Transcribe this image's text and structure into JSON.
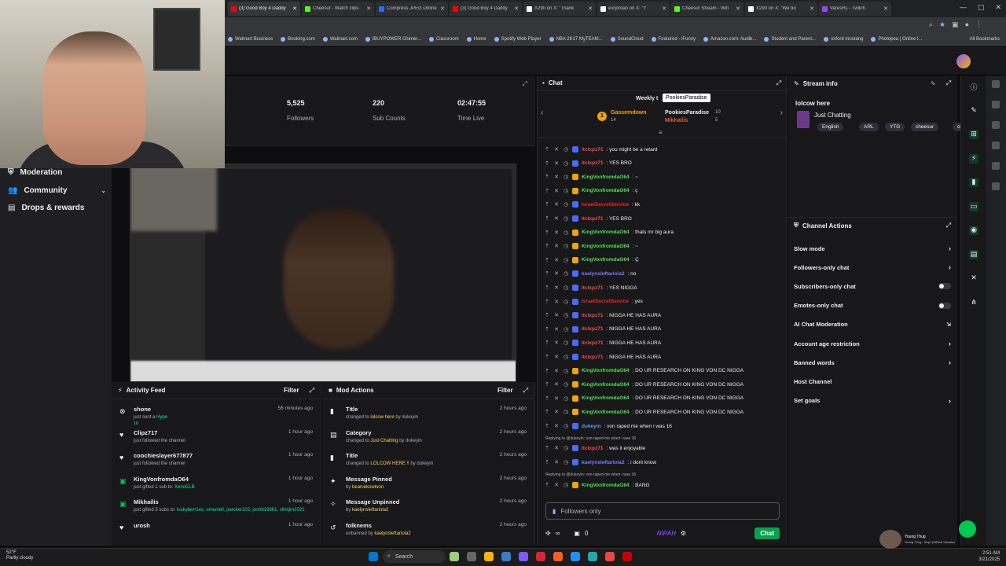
{
  "browser": {
    "tabs": [
      {
        "label": "(3) Good Boy 4 Daddy",
        "color": "#ff0000"
      },
      {
        "label": "Cheesur - Watch clips",
        "color": "#53fc18"
      },
      {
        "label": "Compress JPEG Online",
        "color": "#1a73e8"
      },
      {
        "label": "(3) Good Boy 4 Daddy",
        "color": "#ff0000"
      },
      {
        "label": "X290 on X: \"Thank",
        "color": "#ffffff"
      },
      {
        "label": "evrjordan on X: \"Y",
        "color": "#ffffff"
      },
      {
        "label": "Cheesur Stream - Win",
        "color": "#53fc18"
      },
      {
        "label": "X290 on X: \"We bo",
        "color": "#ffffff"
      },
      {
        "label": "VaresRL - Twitch",
        "color": "#9146ff"
      }
    ],
    "bookmarks": [
      "Walmart Business",
      "Booking.com",
      "Walmart.com",
      "iBUYPOWER Chimer...",
      "Classroom",
      "Home",
      "Spotify Web Player",
      "NBA 2K17 MyTEAM...",
      "SoundCloud",
      "Featured - iFunny",
      "Amazon.com: Audib...",
      "Student and Parent...",
      "oxford mustang",
      "Photopea | Online l..."
    ],
    "all_bookmarks": "All Bookmarks"
  },
  "sidebar": {
    "items": [
      {
        "label": "Moderation",
        "icon": "shield-icon"
      },
      {
        "label": "Community",
        "icon": "people-icon"
      },
      {
        "label": "Drops & rewards",
        "icon": "gift-icon"
      }
    ]
  },
  "stats": [
    {
      "value": "5,525",
      "label": "Followers"
    },
    {
      "value": "220",
      "label": "Sub Counts"
    },
    {
      "value": "02:47:55",
      "label": "Time Live"
    }
  ],
  "activity_feed": {
    "title": "Activity Feed",
    "filter": "Filter",
    "items": [
      {
        "name": "shone",
        "sub": "just sent a",
        "hl": "Hype",
        "extra": "10",
        "time": "56 minutes ago",
        "icon": "x-circle-icon"
      },
      {
        "name": "Clipz717",
        "sub": "just followed the channel",
        "hl": "",
        "extra": "",
        "time": "1 hour ago",
        "icon": "heart-icon"
      },
      {
        "name": "coochieslayer677877",
        "sub": "just followed the channel",
        "hl": "",
        "extra": "",
        "time": "1 hour ago",
        "icon": "heart-icon"
      },
      {
        "name": "KingVonfromdaO64",
        "sub": "just gifted 1 sub to:",
        "hl": "XenoCLB",
        "extra": "",
        "time": "1 hour ago",
        "icon": "gift-icon"
      },
      {
        "name": "Mikhailis",
        "sub": "just gifted 5 subs to:",
        "hl": "luckyberr1es, omuniell, parcker102, joshtt19861, slimjim1021",
        "extra": "",
        "time": "1 hour ago",
        "icon": "gift-icon"
      },
      {
        "name": "urosh",
        "sub": "",
        "hl": "",
        "extra": "",
        "time": "1 hour ago",
        "icon": "heart-icon"
      }
    ]
  },
  "mod_actions": {
    "title": "Mod Actions",
    "filter": "Filter",
    "items": [
      {
        "name": "Title",
        "sub": "changed to",
        "hl": "lolcow here",
        "by": "by dukeyin",
        "time": "2 hours ago",
        "icon": "mic-icon"
      },
      {
        "name": "Category",
        "sub": "changed to",
        "hl": "Just Chatting",
        "by": "by dukeyin",
        "time": "2 hours ago",
        "icon": "category-icon"
      },
      {
        "name": "Title",
        "sub": "changed to",
        "hl": "LOLCOW HERE !!",
        "by": "by dukeyin",
        "time": "2 hours ago",
        "icon": "mic-icon"
      },
      {
        "name": "Message Pinned",
        "sub": "by",
        "hl": "beaniekowloon",
        "by": "",
        "time": "2 hours ago",
        "icon": "pin-icon"
      },
      {
        "name": "Message Unpinned",
        "sub": "by",
        "hl": "kaelynsleftariola2",
        "by": "",
        "time": "2 hours ago",
        "icon": "unpin-icon"
      },
      {
        "name": "folknems",
        "sub": "unbanned by",
        "hl": "kaelynsleftariola2",
        "by": "",
        "time": "2 hours ago",
        "icon": "unban-icon"
      }
    ]
  },
  "chat": {
    "title": "Chat",
    "leaderboard": {
      "title": "Weekly t",
      "tooltip": "PookiesParadise",
      "first": {
        "rank": "1",
        "name": "Gassemdown",
        "score": "14"
      },
      "second": {
        "name": "PookiesParadise",
        "score": "10"
      },
      "third": {
        "name": "Mikhailis",
        "score": "5"
      }
    },
    "lines": [
      {
        "user": "itclxpz71",
        "color": "#ff4a4a",
        "msg": ": you might be a retard"
      },
      {
        "user": "itclxpz71",
        "color": "#ff4a4a",
        "msg": ": YES BRO"
      },
      {
        "user": "KingVonfromdaO64",
        "color": "#4ae54a",
        "msg": ": ~"
      },
      {
        "user": "KingVonfromdaO64",
        "color": "#4ae54a",
        "msg": ": ç"
      },
      {
        "user": "IsraelSecretService",
        "color": "#ff2020",
        "msg": ": kk"
      },
      {
        "user": "itclxpz71",
        "color": "#ff4a4a",
        "msg": ": YES BRO"
      },
      {
        "user": "KingVonfromdaO64",
        "color": "#4ae54a",
        "msg": ": thats mr big aura"
      },
      {
        "user": "KingVonfromdaO64",
        "color": "#4ae54a",
        "msg": ": ~"
      },
      {
        "user": "KingVonfromdaO64",
        "color": "#4ae54a",
        "msg": ": Ç"
      },
      {
        "user": "kaelynsleftariola2",
        "color": "#7a7aff",
        "msg": ": no"
      },
      {
        "user": "itclxpz71",
        "color": "#ff4a4a",
        "msg": ": YES NIGGA"
      },
      {
        "user": "IsraelSecretService",
        "color": "#ff2020",
        "msg": ": yes"
      },
      {
        "user": "itclxpz71",
        "color": "#ff4a4a",
        "msg": ": NIGGA HE HAS AURA"
      },
      {
        "user": "itclxpz71",
        "color": "#ff4a4a",
        "msg": ": NIGGA HE HAS AURA"
      },
      {
        "user": "itclxpz71",
        "color": "#ff4a4a",
        "msg": ": NIGGA HE HAS AURA"
      },
      {
        "user": "itclxpz71",
        "color": "#ff4a4a",
        "msg": ": NIGGA HE HAS AURA"
      },
      {
        "user": "KingVonfromdaO64",
        "color": "#4ae54a",
        "msg": ": DO UR RESEARCH ON KING VON DC NIGGA"
      },
      {
        "user": "KingVonfromdaO64",
        "color": "#4ae54a",
        "msg": ": DO UR RESEARCH ON KING VON DC NIGGA"
      },
      {
        "user": "KingVonfromdaO64",
        "color": "#4ae54a",
        "msg": ": DO UR RESEARCH ON KING VON DC NIGGA"
      },
      {
        "user": "KingVonfromdaO64",
        "color": "#4ae54a",
        "msg": ": DO UR RESEARCH ON KING VON DC NIGGA"
      },
      {
        "user": "dukeyin",
        "color": "#5a9cff",
        "msg": ": von raped me when i was 16"
      }
    ],
    "reply1": "Replying to @dukeyin: von raped me when i was 16",
    "line_after1": {
      "user": "itclxpz71",
      "color": "#ff4a4a",
      "msg": ": was it enjoyable"
    },
    "line_after2": {
      "user": "kaelynsleftariola2",
      "color": "#7a7aff",
      "msg": ": i dont know"
    },
    "reply2": "Replying to @dukeyin: von raped me when i was 16",
    "line_after3": {
      "user": "KingVonfromdaO64",
      "color": "#4ae54a",
      "msg": ": BANG"
    },
    "input_placeholder": "Followers only",
    "points": "0",
    "chat_button": "Chat",
    "brand": "NIPAH"
  },
  "stream_info": {
    "title": "Stream info",
    "stream_title": "lolcow here",
    "category": "Just Chatting",
    "tags": [
      "English",
      "ARL",
      "YTG",
      "cheesur",
      "chud"
    ]
  },
  "channel_actions": {
    "title": "Channel Actions",
    "items": [
      {
        "label": "Slow mode",
        "ctl": "chevron"
      },
      {
        "label": "Followers-only chat",
        "ctl": "chevron"
      },
      {
        "label": "Subscribers-only chat",
        "ctl": "toggle"
      },
      {
        "label": "Emotes-only chat",
        "ctl": "toggle"
      },
      {
        "label": "AI Chat Moderation",
        "ctl": "external"
      },
      {
        "label": "Account age restriction",
        "ctl": "chevron"
      },
      {
        "label": "Banned words",
        "ctl": "chevron"
      },
      {
        "label": "Host Channel",
        "ctl": "none"
      },
      {
        "label": "Set goals",
        "ctl": "chevron"
      }
    ]
  },
  "taskbar": {
    "search": "Search",
    "weather_temp": "52°F",
    "weather_desc": "Partly cloudy",
    "time": "2:51 AM",
    "date": "3/21/2025",
    "now_playing": "Young Thug",
    "now_playing_sub": "Young Thug - Mojo (Official Visualizer)"
  }
}
